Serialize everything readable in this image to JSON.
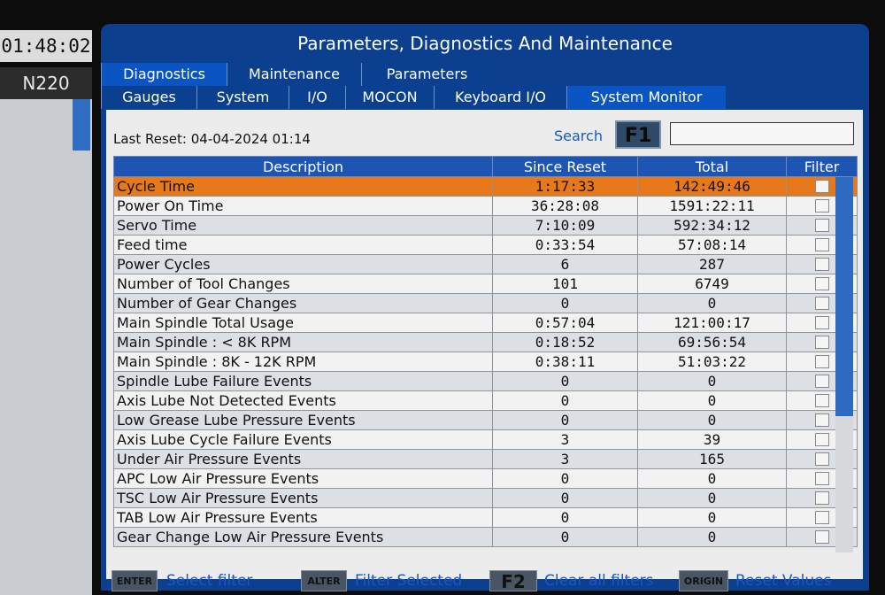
{
  "status": {
    "clock": "01:48:02",
    "program": "N220"
  },
  "window": {
    "title": "Parameters, Diagnostics And Maintenance"
  },
  "tabs_main": [
    {
      "label": "Diagnostics",
      "active": true
    },
    {
      "label": "Maintenance",
      "active": false
    },
    {
      "label": "Parameters",
      "active": false
    }
  ],
  "tabs_sub": [
    {
      "label": "Gauges",
      "active": false
    },
    {
      "label": "System",
      "active": false
    },
    {
      "label": "I/O",
      "active": false
    },
    {
      "label": "MOCON",
      "active": false
    },
    {
      "label": "Keyboard I/O",
      "active": false
    },
    {
      "label": "System Monitor",
      "active": true
    }
  ],
  "panel": {
    "last_reset": "Last Reset: 04-04-2024 01:14",
    "search_label": "Search",
    "search_key": "F1",
    "search_value": ""
  },
  "table": {
    "headers": [
      "Description",
      "Since Reset",
      "Total",
      "Filter"
    ],
    "rows": [
      {
        "description": "Cycle Time",
        "since_reset": "1:17:33",
        "total": "142:49:46",
        "selected": true
      },
      {
        "description": "Power On Time",
        "since_reset": "36:28:08",
        "total": "1591:22:11"
      },
      {
        "description": "Servo Time",
        "since_reset": "7:10:09",
        "total": "592:34:12"
      },
      {
        "description": "Feed time",
        "since_reset": "0:33:54",
        "total": "57:08:14"
      },
      {
        "description": "Power Cycles",
        "since_reset": "6",
        "total": "287"
      },
      {
        "description": "Number of Tool Changes",
        "since_reset": "101",
        "total": "6749"
      },
      {
        "description": "Number of Gear Changes",
        "since_reset": "0",
        "total": "0"
      },
      {
        "description": "Main Spindle Total Usage",
        "since_reset": "0:57:04",
        "total": "121:00:17"
      },
      {
        "description": "Main Spindle : < 8K RPM",
        "since_reset": "0:18:52",
        "total": "69:56:54"
      },
      {
        "description": "Main Spindle : 8K - 12K RPM",
        "since_reset": "0:38:11",
        "total": "51:03:22"
      },
      {
        "description": "Spindle Lube Failure Events",
        "since_reset": "0",
        "total": "0"
      },
      {
        "description": "Axis Lube Not Detected Events",
        "since_reset": "0",
        "total": "0"
      },
      {
        "description": "Low Grease Lube Pressure Events",
        "since_reset": "0",
        "total": "0"
      },
      {
        "description": "Axis Lube Cycle Failure Events",
        "since_reset": "3",
        "total": "39"
      },
      {
        "description": "Under Air Pressure Events",
        "since_reset": "3",
        "total": "165"
      },
      {
        "description": "APC Low Air Pressure Events",
        "since_reset": "0",
        "total": "0"
      },
      {
        "description": "TSC Low Air Pressure Events",
        "since_reset": "0",
        "total": "0"
      },
      {
        "description": "TAB Low Air Pressure Events",
        "since_reset": "0",
        "total": "0"
      },
      {
        "description": "Gear Change Low Air Pressure Events",
        "since_reset": "0",
        "total": "0"
      }
    ]
  },
  "hints": [
    {
      "key": "ENTER",
      "label": "Select filter"
    },
    {
      "key": "ALTER",
      "label": "Filter Selected"
    },
    {
      "key": "F2",
      "label": "Clear all filters"
    },
    {
      "key": "ORIGIN",
      "label": "Reset Values"
    }
  ],
  "colors": {
    "window_blue": "#0d3f8f",
    "header_blue": "#1d55b3",
    "selected_row": "#e8791a",
    "hint_text": "#1559c4"
  }
}
